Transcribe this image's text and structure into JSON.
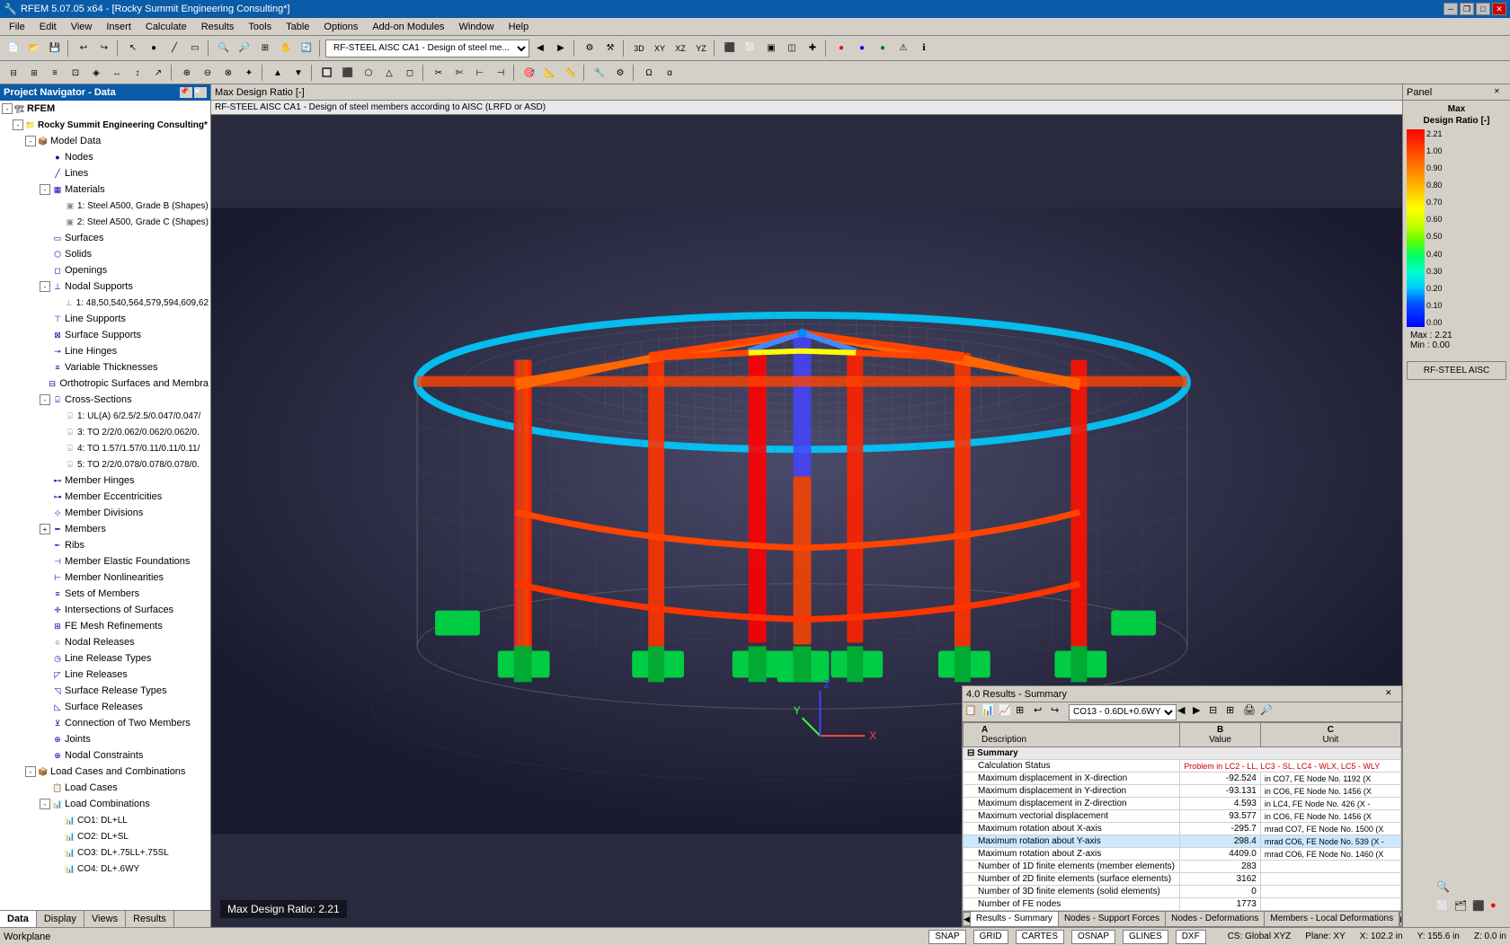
{
  "titleBar": {
    "title": "RFEM 5.07.05 x64 - [Rocky Summit Engineering Consulting*]",
    "minBtn": "─",
    "maxBtn": "□",
    "closeBtn": "✕",
    "restoreBtn": "❐"
  },
  "menuBar": {
    "items": [
      "File",
      "Edit",
      "View",
      "Insert",
      "Calculate",
      "Results",
      "Tools",
      "Table",
      "Options",
      "Add-on Modules",
      "Window",
      "Help"
    ]
  },
  "viewHeader": {
    "label": "Max Design Ratio [-]"
  },
  "viewSubtitle": {
    "label": "RF-STEEL AISC CA1 - Design of steel members according to AISC (LRFD or ASD)"
  },
  "navPanel": {
    "title": "Project Navigator - Data",
    "rfemLabel": "RFEM",
    "projectLabel": "Rocky Summit Engineering Consulting*",
    "treeItems": [
      {
        "id": "model-data",
        "label": "Model Data",
        "level": 2,
        "hasChildren": true,
        "expanded": true
      },
      {
        "id": "nodes",
        "label": "Nodes",
        "level": 3,
        "hasChildren": false
      },
      {
        "id": "lines",
        "label": "Lines",
        "level": 3,
        "hasChildren": false
      },
      {
        "id": "materials",
        "label": "Materials",
        "level": 3,
        "hasChildren": true,
        "expanded": true
      },
      {
        "id": "mat1",
        "label": "1: Steel A500, Grade B (Shapes)",
        "level": 4,
        "hasChildren": false
      },
      {
        "id": "mat2",
        "label": "2: Steel A500, Grade C (Shapes)",
        "level": 4,
        "hasChildren": false
      },
      {
        "id": "surfaces",
        "label": "Surfaces",
        "level": 3,
        "hasChildren": false
      },
      {
        "id": "solids",
        "label": "Solids",
        "level": 3,
        "hasChildren": false
      },
      {
        "id": "openings",
        "label": "Openings",
        "level": 3,
        "hasChildren": false
      },
      {
        "id": "nodal-supports",
        "label": "Nodal Supports",
        "level": 3,
        "hasChildren": true,
        "expanded": true
      },
      {
        "id": "ns1",
        "label": "1: 48,50,540,564,579,594,609,62",
        "level": 4,
        "hasChildren": false
      },
      {
        "id": "line-supports",
        "label": "Line Supports",
        "level": 3,
        "hasChildren": false
      },
      {
        "id": "surface-supports",
        "label": "Surface Supports",
        "level": 3,
        "hasChildren": false
      },
      {
        "id": "line-hinges",
        "label": "Line Hinges",
        "level": 3,
        "hasChildren": false
      },
      {
        "id": "variable-thicknesses",
        "label": "Variable Thicknesses",
        "level": 3,
        "hasChildren": false
      },
      {
        "id": "orthotropic",
        "label": "Orthotropic Surfaces and Membra",
        "level": 3,
        "hasChildren": false
      },
      {
        "id": "cross-sections",
        "label": "Cross-Sections",
        "level": 3,
        "hasChildren": true,
        "expanded": true
      },
      {
        "id": "cs1",
        "label": "1: UL(A) 6/2.5/2.5/0.047/0.047/",
        "level": 4,
        "hasChildren": false
      },
      {
        "id": "cs3",
        "label": "3: TO 2/2/0.062/0.062/0.062/0.",
        "level": 4,
        "hasChildren": false
      },
      {
        "id": "cs4",
        "label": "4: TO 1.57/1.57/0.11/0.11/0.11/",
        "level": 4,
        "hasChildren": false
      },
      {
        "id": "cs5",
        "label": "5: TO 2/2/0.078/0.078/0.078/0.",
        "level": 4,
        "hasChildren": false
      },
      {
        "id": "member-hinges",
        "label": "Member Hinges",
        "level": 3,
        "hasChildren": false
      },
      {
        "id": "member-eccentricities",
        "label": "Member Eccentricities",
        "level": 3,
        "hasChildren": false
      },
      {
        "id": "member-divisions",
        "label": "Member Divisions",
        "level": 3,
        "hasChildren": false
      },
      {
        "id": "members",
        "label": "Members",
        "level": 3,
        "hasChildren": true,
        "expanded": false
      },
      {
        "id": "ribs",
        "label": "Ribs",
        "level": 3,
        "hasChildren": false
      },
      {
        "id": "member-elastic",
        "label": "Member Elastic Foundations",
        "level": 3,
        "hasChildren": false
      },
      {
        "id": "member-nonlinear",
        "label": "Member Nonlinearities",
        "level": 3,
        "hasChildren": false
      },
      {
        "id": "sets-of-members",
        "label": "Sets of Members",
        "level": 3,
        "hasChildren": false
      },
      {
        "id": "intersections",
        "label": "Intersections of Surfaces",
        "level": 3,
        "hasChildren": false
      },
      {
        "id": "fe-mesh",
        "label": "FE Mesh Refinements",
        "level": 3,
        "hasChildren": false
      },
      {
        "id": "nodal-releases",
        "label": "Nodal Releases",
        "level": 3,
        "hasChildren": false
      },
      {
        "id": "line-release-types",
        "label": "Line Release Types",
        "level": 3,
        "hasChildren": false
      },
      {
        "id": "line-releases",
        "label": "Line Releases",
        "level": 3,
        "hasChildren": false
      },
      {
        "id": "surface-release-types",
        "label": "Surface Release Types",
        "level": 3,
        "hasChildren": false
      },
      {
        "id": "surface-releases",
        "label": "Surface Releases",
        "level": 3,
        "hasChildren": false
      },
      {
        "id": "connection-two",
        "label": "Connection of Two Members",
        "level": 3,
        "hasChildren": false
      },
      {
        "id": "joints",
        "label": "Joints",
        "level": 3,
        "hasChildren": false
      },
      {
        "id": "nodal-constraints",
        "label": "Nodal Constraints",
        "level": 3,
        "hasChildren": false
      },
      {
        "id": "load-cases-combinations",
        "label": "Load Cases and Combinations",
        "level": 2,
        "hasChildren": true,
        "expanded": true
      },
      {
        "id": "load-cases",
        "label": "Load Cases",
        "level": 3,
        "hasChildren": false
      },
      {
        "id": "load-combinations",
        "label": "Load Combinations",
        "level": 3,
        "hasChildren": true,
        "expanded": true
      },
      {
        "id": "co1",
        "label": "CO1: DL+LL",
        "level": 4,
        "hasChildren": false
      },
      {
        "id": "co2",
        "label": "CO2: DL+SL",
        "level": 4,
        "hasChildren": false
      },
      {
        "id": "co3",
        "label": "CO3: DL+.75LL+.75SL",
        "level": 4,
        "hasChildren": false
      },
      {
        "id": "co4",
        "label": "CO4: DL+.6WY",
        "level": 4,
        "hasChildren": false
      }
    ],
    "tabs": [
      "Data",
      "Display",
      "Views",
      "Results"
    ]
  },
  "rightPanel": {
    "title": "Panel",
    "closeBtn": "✕",
    "legend": {
      "title": "Max",
      "subtitle": "Design Ratio [-]",
      "entries": [
        {
          "color": "#ff0000",
          "value": "2.21"
        },
        {
          "color": "#ff2200",
          "value": "1.00"
        },
        {
          "color": "#ff6600",
          "value": "0.90"
        },
        {
          "color": "#ff9900",
          "value": "0.80"
        },
        {
          "color": "#ffcc00",
          "value": "0.70"
        },
        {
          "color": "#ffff00",
          "value": "0.60"
        },
        {
          "color": "#ccff00",
          "value": "0.50"
        },
        {
          "color": "#66ff00",
          "value": "0.40"
        },
        {
          "color": "#00ff66",
          "value": "0.30"
        },
        {
          "color": "#00ffcc",
          "value": "0.20"
        },
        {
          "color": "#00ccff",
          "value": "0.10"
        },
        {
          "color": "#0000ff",
          "value": "0.00"
        }
      ],
      "maxLabel": "Max :",
      "maxValue": "2.21",
      "minLabel": "Min :",
      "minValue": "0.00",
      "rfSteelBtn": "RF-STEEL AISC"
    }
  },
  "resultsPanel": {
    "title": "4.0 Results - Summary",
    "closeBtn": "✕",
    "comboValue": "CO13 - 0.6DL+0.6WY",
    "columns": [
      {
        "id": "A",
        "label": "Description"
      },
      {
        "id": "B",
        "label": "Value"
      },
      {
        "id": "C",
        "label": "Unit"
      }
    ],
    "summaryLabel": "Summary",
    "rows": [
      {
        "desc": "Calculation Status",
        "value": "Problem in LC2 - LL, LC3 - SL, LC4 - WLX, LC5 - WLY",
        "unit": "",
        "isStatus": true
      },
      {
        "desc": "Maximum displacement in X-direction",
        "value": "-92.524",
        "unit": "in  CO7, FE Node No. 1192  (X",
        "isStatus": false
      },
      {
        "desc": "Maximum displacement in Y-direction",
        "value": "-93.131",
        "unit": "in  CO6, FE Node No. 1456  (X",
        "isStatus": false
      },
      {
        "desc": "Maximum displacement in Z-direction",
        "value": "4.593",
        "unit": "in  LC4, FE Node No. 426  (X -",
        "isStatus": false
      },
      {
        "desc": "Maximum vectorial displacement",
        "value": "93.577",
        "unit": "in  CO6, FE Node No. 1456  (X",
        "isStatus": false
      },
      {
        "desc": "Maximum rotation about X-axis",
        "value": "-295.7",
        "unit": "mrad  CO7, FE Node No. 1500  (X",
        "isStatus": false
      },
      {
        "desc": "Maximum rotation about Y-axis",
        "value": "298.4",
        "unit": "mrad  CO6, FE Node No. 539  (X -",
        "isStatus": false,
        "selected": true
      },
      {
        "desc": "Maximum rotation about Z-axis",
        "value": "4409.0",
        "unit": "mrad  CO6, FE Node No. 1460  (X",
        "isStatus": false
      },
      {
        "desc": "Number of 1D finite elements (member elements)",
        "value": "283",
        "unit": "",
        "isStatus": false
      },
      {
        "desc": "Number of 2D finite elements (surface elements)",
        "value": "3162",
        "unit": "",
        "isStatus": false
      },
      {
        "desc": "Number of 3D finite elements (solid elements)",
        "value": "0",
        "unit": "",
        "isStatus": false
      },
      {
        "desc": "Number of FE nodes",
        "value": "1773",
        "unit": "",
        "isStatus": false
      }
    ],
    "tabs": [
      "Results - Summary",
      "Nodes - Support Forces",
      "Nodes - Deformations",
      "Members - Local Deformations"
    ]
  },
  "statusBar": {
    "workplaneLabel": "Workplane",
    "maxDesignRatio": "Max Design Ratio: 2.21",
    "snap": "SNAP",
    "grid": "GRID",
    "cartes": "CARTES",
    "osnap": "OSNAP",
    "glines": "GLINES",
    "dxf": "DXF",
    "cs": "CS: Global XYZ",
    "plane": "Plane: XY",
    "x": "X: 102.2 in",
    "y": "Y: 155.6 in",
    "z": "Z: 0.0 in"
  }
}
